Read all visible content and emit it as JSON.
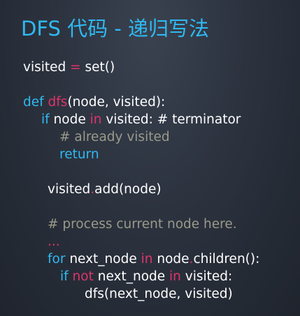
{
  "slide": {
    "title": "DFS 代码 - 递归写法"
  },
  "code": {
    "l1": {
      "a": "visited ",
      "b": "=",
      "c": " set()"
    },
    "l2": {
      "a": "def",
      "b": " ",
      "c": "dfs",
      "d": "(node, visited):"
    },
    "l3": {
      "a": "if",
      "b": " node ",
      "c": "in",
      "d": " visited: # terminator"
    },
    "l4": {
      "a": "# already visited"
    },
    "l5": {
      "a": "return"
    },
    "l6": {
      "a": "visited",
      "b": ".",
      "c": "add(node)"
    },
    "l7": {
      "a": "# process current node here."
    },
    "l8": {
      "a": "..."
    },
    "l9": {
      "a": "for",
      "b": " next_node ",
      "c": "in",
      "d": " node",
      "e": ".",
      "f": "children():"
    },
    "l10": {
      "a": "if",
      "b": " ",
      "c": "not",
      "d": " next_node ",
      "e": "in",
      "f": " visited:"
    },
    "l11": {
      "a": "dfs(next_node, visited)"
    }
  },
  "colors": {
    "keyword": "#2fb9f2",
    "operator": "#e0336b",
    "comment": "#9a9a8a",
    "text": "#ffffff",
    "background": "#2c333f"
  }
}
